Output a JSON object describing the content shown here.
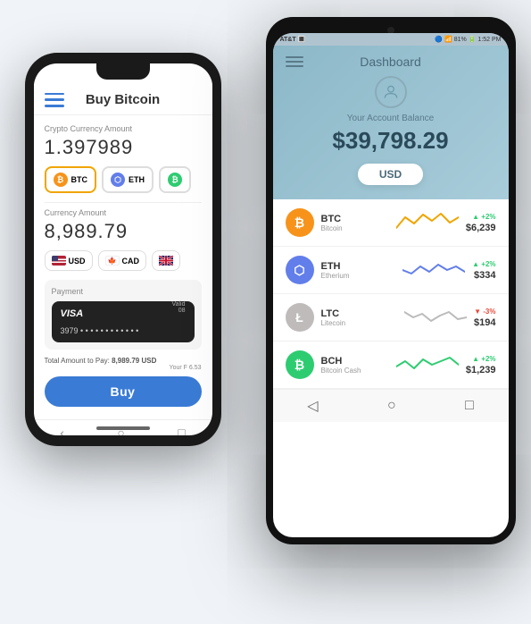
{
  "leftPhone": {
    "header": {
      "title": "Buy Bitcoin"
    },
    "cryptoAmount": {
      "label": "Crypto Currency Amount",
      "value": "1.397989"
    },
    "cryptoCurrencies": [
      {
        "symbol": "BTC",
        "icon": "₿",
        "bg": "#f7931a",
        "active": true
      },
      {
        "symbol": "ETH",
        "icon": "⬡",
        "bg": "#627eea",
        "active": false
      },
      {
        "symbol": "BCH",
        "icon": "₿",
        "bg": "#2ecc71",
        "active": false
      }
    ],
    "fiatAmount": {
      "label": "Currency Amount",
      "value": "8,989.79"
    },
    "fiatCurrencies": [
      {
        "symbol": "USD",
        "flag": "us"
      },
      {
        "symbol": "CAD",
        "flag": "ca"
      },
      {
        "symbol": "GBP",
        "flag": "uk"
      }
    ],
    "payment": {
      "label": "Payment",
      "cardBrand": "VISA",
      "validLabel": "Valid",
      "validDate": "08",
      "cardNumber": "3979 • • • •  • • • •  • • • •"
    },
    "total": {
      "label": "Total Amount to Pay:",
      "value": "8,989.79 USD",
      "feeLabel": "Your F",
      "feeValue": "6.53"
    },
    "buyButton": "Buy",
    "navIcons": [
      "‹",
      "○",
      "□"
    ]
  },
  "rightPhone": {
    "statusBar": {
      "carrier": "AT&T 🔳",
      "time": "1:52 PM",
      "icons": "🔵 📶 81% 🔋"
    },
    "header": {
      "title": "Dashboard",
      "balanceLabel": "Your Account Balance",
      "balance": "$39,798.29",
      "currency": "USD"
    },
    "cryptos": [
      {
        "symbol": "BTC",
        "name": "Bitcoin",
        "icon": "₿",
        "bg": "#f7931a",
        "change": "+2%",
        "changeDir": "up",
        "price": "$6,239",
        "chartColor": "#f0a500",
        "chartPoints": "0,20 10,8 20,15 30,5 40,12 50,4 60,14 70,8"
      },
      {
        "symbol": "ETH",
        "name": "Etherium",
        "icon": "⬡",
        "bg": "#627eea",
        "change": "+2%",
        "changeDir": "up",
        "price": "$334",
        "chartColor": "#627eea",
        "chartPoints": "0,14 10,18 20,10 30,16 40,8 50,14 60,10 70,16"
      },
      {
        "symbol": "LTC",
        "name": "Litecoin",
        "icon": "Ł",
        "bg": "#bfbbbb",
        "change": "-3%",
        "changeDir": "down",
        "price": "$194",
        "chartColor": "#bbb",
        "chartPoints": "0,8 10,14 20,10 30,18 40,12 50,8 60,16 70,14"
      },
      {
        "symbol": "BCH",
        "name": "Bitcoin Cash",
        "icon": "₿",
        "bg": "#2ecc71",
        "change": "+2%",
        "changeDir": "up",
        "price": "$1,239",
        "chartColor": "#2ecc71",
        "chartPoints": "0,16 10,10 20,18 30,8 40,14 50,10 60,6 70,14"
      }
    ],
    "navIcons": [
      "◁",
      "○",
      "□"
    ]
  }
}
